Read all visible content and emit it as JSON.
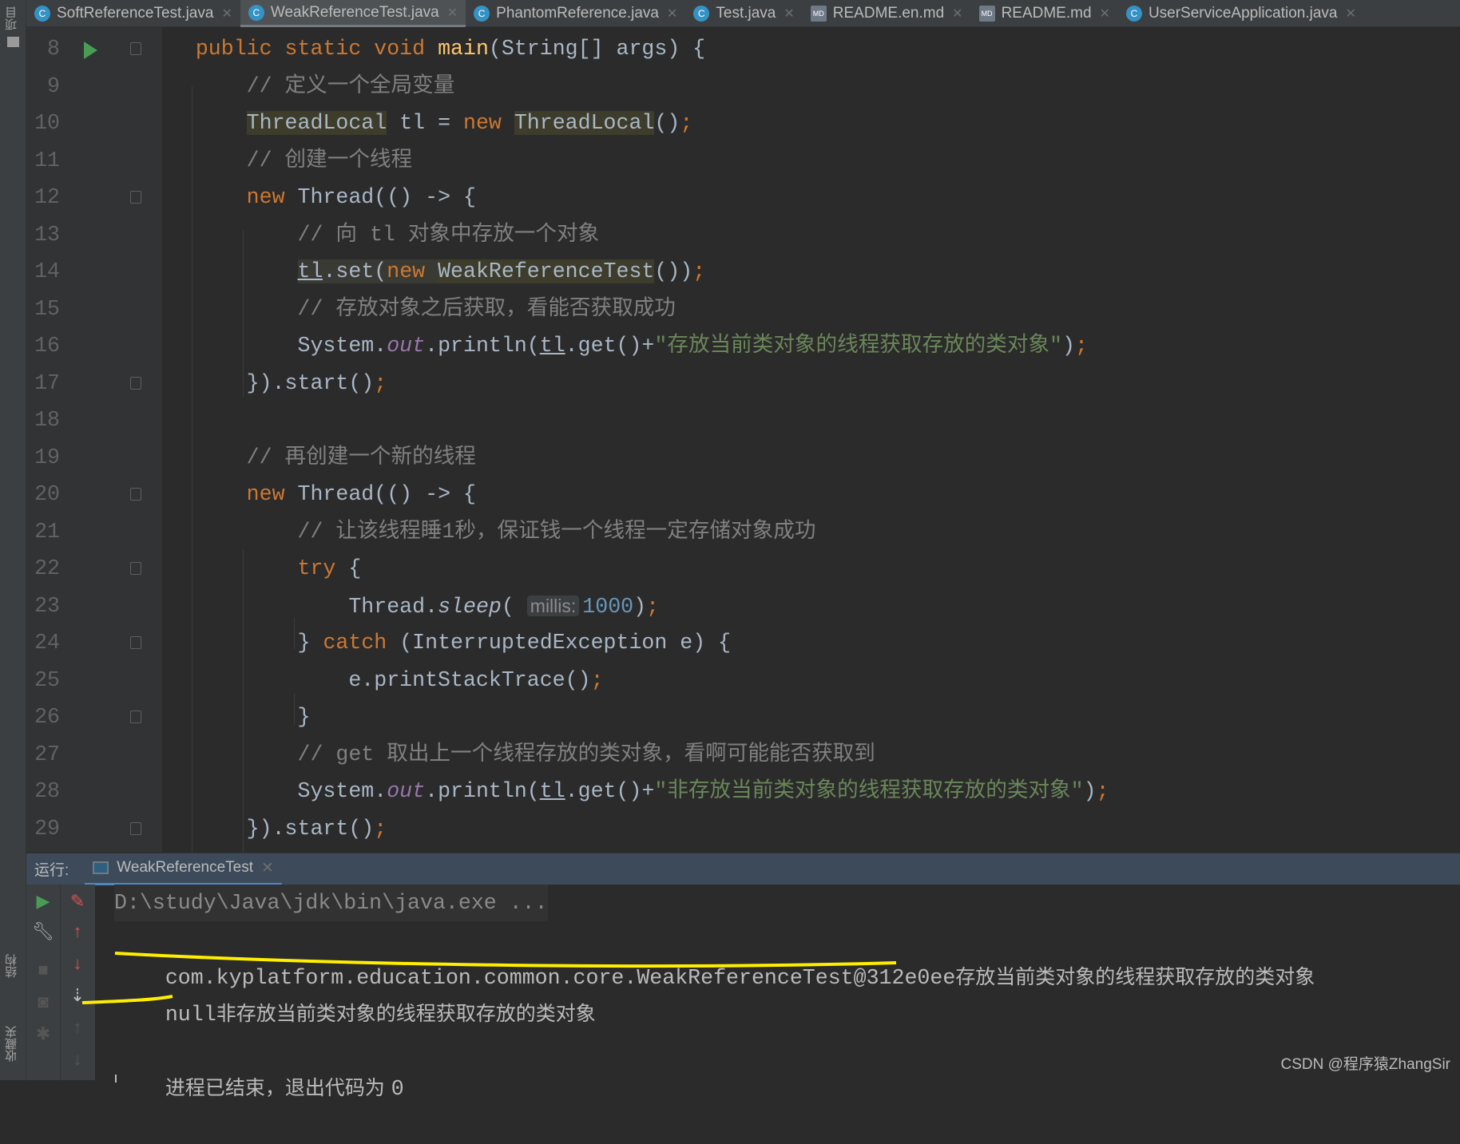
{
  "sidebar": {
    "project": "项目",
    "structure": "结构",
    "favorites": "收藏夹"
  },
  "tabs": [
    {
      "label": "SoftReferenceTest.java",
      "icon": "java-class-icon",
      "active": false
    },
    {
      "label": "WeakReferenceTest.java",
      "icon": "java-class-icon",
      "active": true
    },
    {
      "label": "PhantomReference.java",
      "icon": "java-class-locked-icon",
      "active": false
    },
    {
      "label": "Test.java",
      "icon": "java-class-icon",
      "active": false
    },
    {
      "label": "README.en.md",
      "icon": "markdown-icon",
      "active": false
    },
    {
      "label": "README.md",
      "icon": "markdown-icon",
      "active": false
    },
    {
      "label": "UserServiceApplication.java",
      "icon": "spring-class-icon",
      "active": false
    }
  ],
  "editor": {
    "lines": [
      {
        "n": "8",
        "t": [
          [
            "",
            "    "
          ],
          [
            "kw",
            "public static void "
          ],
          [
            "fn",
            "main"
          ],
          [
            "",
            "(String[] args) {"
          ]
        ]
      },
      {
        "n": "9",
        "t": [
          [
            "",
            "        "
          ],
          [
            "cm",
            "// 定义一个全局变量"
          ]
        ]
      },
      {
        "n": "10",
        "t": [
          [
            "",
            "        "
          ],
          [
            "hl",
            "ThreadLocal"
          ],
          [
            "",
            " tl = "
          ],
          [
            "kw",
            "new "
          ],
          [
            "hl",
            "ThreadLocal"
          ],
          [
            "",
            "()"
          ],
          [
            "kw",
            ";"
          ]
        ]
      },
      {
        "n": "11",
        "t": [
          [
            "",
            "        "
          ],
          [
            "cm",
            "// 创建一个线程"
          ]
        ]
      },
      {
        "n": "12",
        "t": [
          [
            "",
            "        "
          ],
          [
            "kw",
            "new "
          ],
          [
            "",
            "Thread(() -> {"
          ]
        ]
      },
      {
        "n": "13",
        "t": [
          [
            "",
            "            "
          ],
          [
            "cm",
            "// 向 tl 对象中存放一个对象"
          ]
        ]
      },
      {
        "n": "14",
        "t": [
          [
            "",
            "            "
          ],
          [
            "ulh",
            "tl"
          ],
          [
            "hlp",
            ".set("
          ],
          [
            "kw hlp",
            "new "
          ],
          [
            "hl",
            "WeakReferenceTest"
          ],
          [
            "",
            "())"
          ],
          [
            "kw",
            ";"
          ]
        ]
      },
      {
        "n": "15",
        "t": [
          [
            "",
            "            "
          ],
          [
            "cm",
            "// 存放对象之后获取，看能否获取成功"
          ]
        ]
      },
      {
        "n": "16",
        "t": [
          [
            "",
            "            System."
          ],
          [
            "it",
            "out"
          ],
          [
            "",
            ".println("
          ],
          [
            "ul",
            "tl"
          ],
          [
            "",
            ".get()+"
          ],
          [
            "st",
            "\"存放当前类对象的线程获取存放的类对象\""
          ],
          [
            "",
            ")"
          ],
          [
            "kw",
            ";"
          ]
        ]
      },
      {
        "n": "17",
        "t": [
          [
            "",
            "        }).start()"
          ],
          [
            "kw",
            ";"
          ]
        ]
      },
      {
        "n": "18",
        "t": [
          [
            "",
            ""
          ]
        ]
      },
      {
        "n": "19",
        "t": [
          [
            "",
            "        "
          ],
          [
            "cm",
            "// 再创建一个新的线程"
          ]
        ]
      },
      {
        "n": "20",
        "t": [
          [
            "",
            "        "
          ],
          [
            "kw",
            "new "
          ],
          [
            "",
            "Thread(() -> {"
          ]
        ]
      },
      {
        "n": "21",
        "t": [
          [
            "",
            "            "
          ],
          [
            "cm",
            "// 让该线程睡1秒，保证钱一个线程一定存储对象成功"
          ]
        ]
      },
      {
        "n": "22",
        "t": [
          [
            "",
            "            "
          ],
          [
            "kw",
            "try "
          ],
          [
            "",
            "{"
          ]
        ]
      },
      {
        "n": "23",
        "t": [
          [
            "",
            "                Thread."
          ],
          [
            "itm",
            "sleep"
          ],
          [
            "",
            "( "
          ],
          [
            "hint",
            "millis:"
          ],
          [
            "nu",
            "1000"
          ],
          [
            "",
            ")"
          ],
          [
            "kw",
            ";"
          ]
        ]
      },
      {
        "n": "24",
        "t": [
          [
            "",
            "            } "
          ],
          [
            "kw",
            "catch "
          ],
          [
            "",
            "(InterruptedException e) {"
          ]
        ]
      },
      {
        "n": "25",
        "t": [
          [
            "",
            "                e.printStackTrace()"
          ],
          [
            "kw",
            ";"
          ]
        ]
      },
      {
        "n": "26",
        "t": [
          [
            "",
            "            }"
          ]
        ]
      },
      {
        "n": "27",
        "t": [
          [
            "",
            "            "
          ],
          [
            "cm",
            "// get 取出上一个线程存放的类对象，看啊可能能否获取到"
          ]
        ]
      },
      {
        "n": "28",
        "t": [
          [
            "",
            "            System."
          ],
          [
            "it",
            "out"
          ],
          [
            "",
            ".println("
          ],
          [
            "ul",
            "tl"
          ],
          [
            "",
            ".get()+"
          ],
          [
            "st",
            "\"非存放当前类对象的线程获取存放的类对象\""
          ],
          [
            "",
            ")"
          ],
          [
            "kw",
            ";"
          ]
        ]
      },
      {
        "n": "29",
        "t": [
          [
            "",
            "        }).start()"
          ],
          [
            "kw",
            ";"
          ]
        ]
      }
    ]
  },
  "run": {
    "label": "运行:",
    "tab": "WeakReferenceTest"
  },
  "console": {
    "cmd": "D:\\study\\Java\\jdk\\bin\\java.exe ...",
    "out1_obj": "com.kyplatform.education.common.core.WeakReferenceTest@312e0ee",
    "out1_msg": "存放当前类对象的线程获取存放的类对象",
    "out2_obj": "null",
    "out2_msg": "非存放当前类对象的线程获取存放的类对象",
    "exit_label": "进程已结束，退出代码为 ",
    "exit_code": "0"
  },
  "watermark": "CSDN @程序猿ZhangSir",
  "colors": {
    "keyword": "#cc7832",
    "comment": "#808080",
    "string": "#6a8759",
    "annotation": "#ffff00"
  }
}
